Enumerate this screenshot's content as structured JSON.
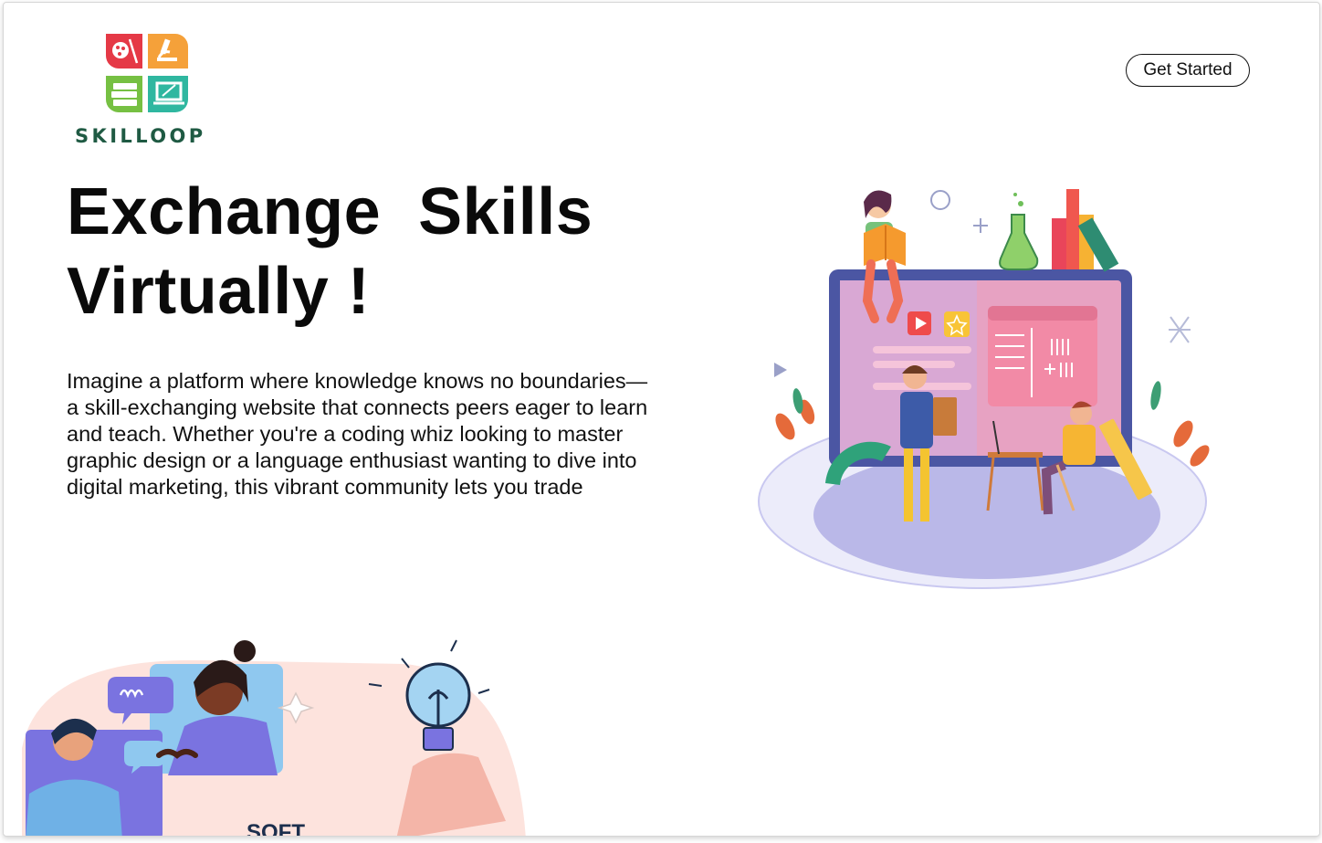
{
  "brand": {
    "name": "SKILLOOP",
    "tile_colors": [
      "#e53946",
      "#f5a13a",
      "#76c043",
      "#2fb7a0"
    ]
  },
  "header": {
    "cta_label": "Get Started"
  },
  "hero": {
    "headline": "Exchange  Skills\nVirtually !",
    "description": "Imagine a platform where knowledge knows no boundaries—a skill-exchanging website that connects peers eager to learn and teach. Whether you're a coding whiz looking to master graphic design or a language enthusiast wanting to dive into digital marketing, this vibrant community lets you trade"
  },
  "footer_art": {
    "caption": "SOFT"
  },
  "colors": {
    "accent_purple": "#7a73e0",
    "pale_pink": "#fde3dd",
    "text": "#0a0a0a"
  }
}
